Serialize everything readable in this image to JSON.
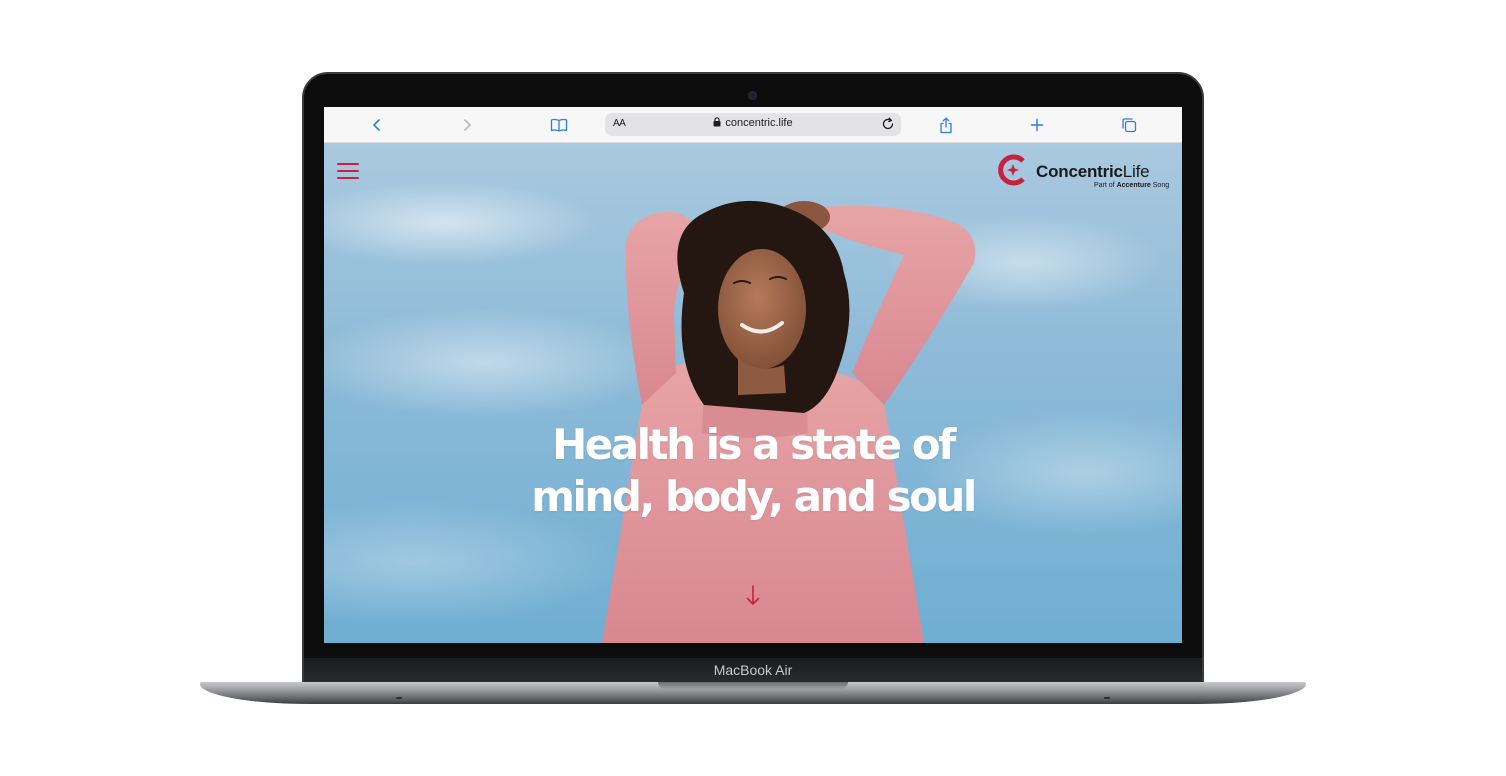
{
  "device": {
    "label": "MacBook Air"
  },
  "browser": {
    "address_bar": {
      "text_size_label": "AA",
      "url": "concentric.life"
    },
    "icons": {
      "back": "chevron-left-icon",
      "forward": "chevron-right-icon",
      "bookmarks": "book-icon",
      "lock": "lock-icon",
      "reload": "reload-icon",
      "share": "share-icon",
      "new_tab": "plus-icon",
      "tabs": "tabs-icon"
    }
  },
  "site": {
    "logo": {
      "name_bold": "Concentric",
      "name_light": "Life",
      "sub_prefix": "Part of",
      "sub_bold": "Accenture",
      "sub_suffix": "Song"
    },
    "hero": {
      "headline_line1": "Health is a state of",
      "headline_line2": "mind, body, and soul"
    },
    "colors": {
      "accent": "#c8203f",
      "headline": "#ffffff",
      "sky": "#8fbbd8",
      "sweater": "#e39a9f"
    }
  }
}
